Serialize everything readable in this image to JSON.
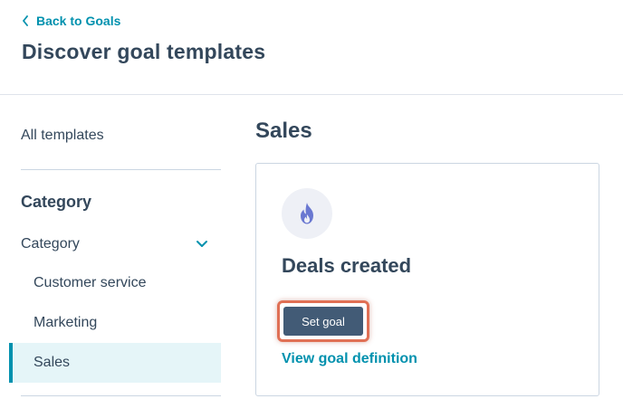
{
  "header": {
    "back_label": "Back to Goals",
    "title": "Discover goal templates"
  },
  "sidebar": {
    "all_templates": "All templates",
    "category_heading": "Category",
    "category_toggle_label": "Category",
    "items": [
      {
        "label": "Customer service"
      },
      {
        "label": "Marketing"
      },
      {
        "label": "Sales",
        "selected": true
      }
    ]
  },
  "main": {
    "section_title": "Sales",
    "card": {
      "icon": "flame-icon",
      "title": "Deals created",
      "primary_button": "Set goal",
      "link": "View goal definition"
    }
  },
  "colors": {
    "accent_link": "#0091ae",
    "text": "#33475b",
    "button_bg": "#425b76",
    "selected_bg": "#e5f5f8",
    "highlight": "#e07055",
    "icon_purple": "#6a78d1"
  }
}
